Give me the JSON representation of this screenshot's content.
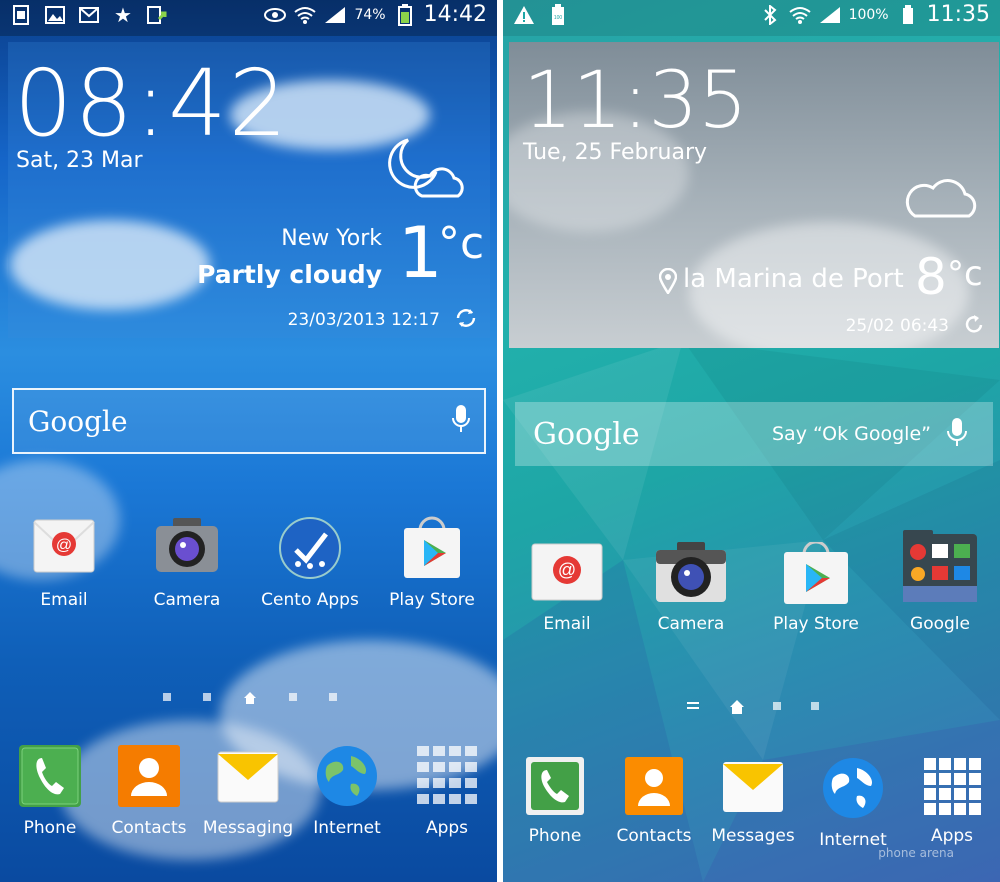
{
  "left_phone": {
    "status": {
      "battery_pct": "74%",
      "time": "14:42"
    },
    "widget": {
      "time": "08:42",
      "date": "Sat, 23 Mar",
      "city": "New York",
      "condition": "Partly cloudy",
      "temp": "1",
      "unit": "°c",
      "updated": "23/03/2013 12:17"
    },
    "search": {
      "logo": "Google"
    },
    "apps": [
      {
        "label": "Email"
      },
      {
        "label": "Camera"
      },
      {
        "label": "Cento Apps"
      },
      {
        "label": "Play Store"
      }
    ],
    "dock": [
      {
        "label": "Phone"
      },
      {
        "label": "Contacts"
      },
      {
        "label": "Messaging"
      },
      {
        "label": "Internet"
      },
      {
        "label": "Apps"
      }
    ]
  },
  "right_phone": {
    "status": {
      "battery_pct": "100%",
      "time": "11:35"
    },
    "widget": {
      "time": "11:35",
      "date": "Tue, 25 February",
      "city": "la Marina de Port",
      "temp": "8",
      "unit": "°c",
      "updated": "25/02 06:43"
    },
    "search": {
      "logo": "Google",
      "hint": "Say “Ok Google”"
    },
    "apps": [
      {
        "label": "Email"
      },
      {
        "label": "Camera"
      },
      {
        "label": "Play Store"
      },
      {
        "label": "Google"
      }
    ],
    "dock": [
      {
        "label": "Phone"
      },
      {
        "label": "Contacts"
      },
      {
        "label": "Messages"
      },
      {
        "label": "Internet"
      },
      {
        "label": "Apps"
      }
    ]
  },
  "watermark": "phone arena"
}
